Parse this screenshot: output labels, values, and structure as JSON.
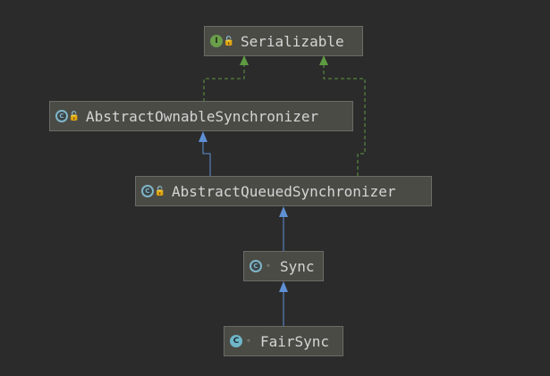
{
  "colors": {
    "background": "#2b2b2b",
    "node_fill": "#4b4b46",
    "node_border": "#6b6b66",
    "extends_arrow": "#5f8fd4",
    "implements_arrow": "#5f9a42",
    "text": "#d4d4d4"
  },
  "nodes": {
    "serializable": {
      "label": "Serializable",
      "kind_icon": "interface-icon",
      "kind_glyph": "I",
      "modifier_icon": "public-lock-icon",
      "modifier_glyph": "🔓"
    },
    "aos": {
      "label": "AbstractOwnableSynchronizer",
      "kind_icon": "abstract-class-icon",
      "kind_glyph": "C",
      "modifier_icon": "public-lock-icon",
      "modifier_glyph": "🔓"
    },
    "aqs": {
      "label": "AbstractQueuedSynchronizer",
      "kind_icon": "abstract-class-icon",
      "kind_glyph": "C",
      "modifier_icon": "public-lock-icon",
      "modifier_glyph": "🔓"
    },
    "sync": {
      "label": "Sync",
      "kind_icon": "abstract-class-icon",
      "kind_glyph": "C",
      "modifier_icon": "package-private-icon",
      "modifier_glyph": "∘"
    },
    "fairsync": {
      "label": "FairSync",
      "kind_icon": "class-icon",
      "kind_glyph": "C",
      "modifier_icon": "package-private-icon",
      "modifier_glyph": "∘"
    }
  },
  "edges": [
    {
      "from": "aos",
      "to": "serializable",
      "type": "implements"
    },
    {
      "from": "aqs",
      "to": "serializable",
      "type": "implements"
    },
    {
      "from": "aqs",
      "to": "aos",
      "type": "extends"
    },
    {
      "from": "sync",
      "to": "aqs",
      "type": "extends"
    },
    {
      "from": "fairsync",
      "to": "sync",
      "type": "extends"
    }
  ]
}
